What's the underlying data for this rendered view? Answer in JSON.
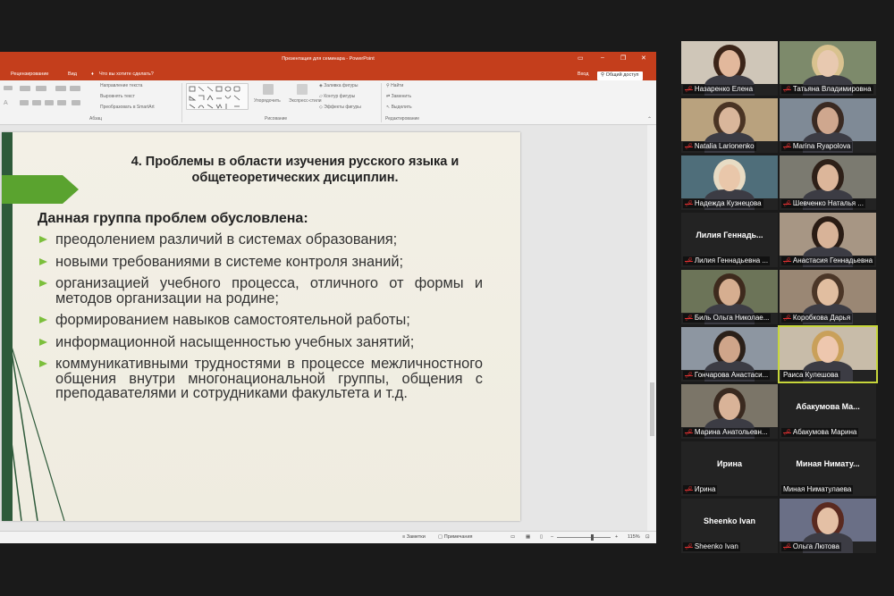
{
  "ppt": {
    "window_title": "Презентация для семинара - PowerPoint",
    "tabs": [
      "Рецензирование",
      "Вид"
    ],
    "tell_me": "Что вы хотите сделать?",
    "sign_in": "Вход",
    "share": "Общий доступ",
    "ribbon": {
      "paragraph_label": "Абзац",
      "drawing_label": "Рисование",
      "editing_label": "Редактирование",
      "text_direction": "Направление текста",
      "align_text": "Выровнять текст",
      "convert_smartart": "Преобразовать в SmartArt",
      "arrange": "Упорядочить",
      "express_styles": "Экспресс-стили",
      "shape_fill": "Заливка фигуры",
      "shape_outline": "Контур фигуры",
      "shape_effects": "Эффекты фигуры",
      "find": "Найти",
      "replace": "Заменить",
      "select": "Выделить"
    },
    "status": {
      "notes": "Заметки",
      "comments": "Примечания",
      "zoom": "115%"
    }
  },
  "slide": {
    "title_line1": "4. Проблемы в области изучения русского языка и",
    "title_line2": "общетеоретических дисциплин.",
    "heading": "Данная группа проблем обусловлена:",
    "bullets": [
      "преодолением различий в системах образования;",
      "новыми требованиями в системе контроля знаний;",
      "организацией учебного процесса, отличного от формы и методов организации на родине;",
      "формированием навыков самостоятельной работы;",
      "информационной насыщенностью учебных занятий;",
      "коммуникативными трудностями в процессе межличностного общения внутри многонациональной группы, общения с преподавателями и сотрудниками факультета и т.д."
    ]
  },
  "participants": [
    {
      "name": "Назаренко Елена",
      "muted": true,
      "video": true
    },
    {
      "name": "Татьяна Владимировна",
      "muted": true,
      "video": true
    },
    {
      "name": "Natalia Larionenko",
      "muted": true,
      "video": true
    },
    {
      "name": "Marina Ryapolova",
      "muted": true,
      "video": true
    },
    {
      "name": "Надежда Кузнецова",
      "muted": true,
      "video": true
    },
    {
      "name": "Шевченко Наталья ...",
      "muted": true,
      "video": true
    },
    {
      "name": "Лилия Геннадьевна ...",
      "big": "Лилия Геннадь...",
      "muted": true,
      "video": false
    },
    {
      "name": "Анастасия Геннадьевна",
      "muted": true,
      "video": true
    },
    {
      "name": "Биль Ольга Николае...",
      "muted": true,
      "video": true
    },
    {
      "name": "Коробкова Дарья",
      "muted": true,
      "video": true
    },
    {
      "name": "Гончарова Анастаси...",
      "muted": true,
      "video": true
    },
    {
      "name": "Раиса Кулешова",
      "muted": false,
      "video": true,
      "active": true
    },
    {
      "name": "Марина Анатольевн...",
      "muted": true,
      "video": true
    },
    {
      "name": "Абакумова Марина",
      "big": "Абакумова Ма...",
      "muted": true,
      "video": false
    },
    {
      "name": "Ирина",
      "big": "Ирина",
      "muted": true,
      "video": false
    },
    {
      "name": "Миная Ниматулаева",
      "big": "Миная Нимату...",
      "muted": false,
      "video": false
    },
    {
      "name": "Sheenko Ivan",
      "big": "Sheenko Ivan",
      "muted": true,
      "video": false
    },
    {
      "name": "Ольга Лютова",
      "muted": true,
      "video": true
    }
  ],
  "colors": {
    "ppt_accent": "#c43e1c",
    "slide_bar": "#2e5a3a",
    "arrow_green": "#7cbf3c",
    "active_speaker": "#c7d63b"
  }
}
